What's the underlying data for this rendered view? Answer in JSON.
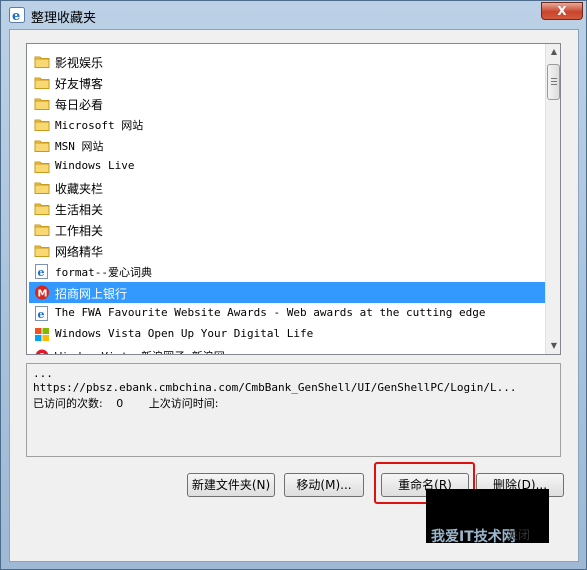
{
  "window": {
    "title": "整理收藏夹",
    "close_label": "X"
  },
  "list": {
    "items": [
      {
        "label": "影视娱乐",
        "icon": "folder-icon",
        "zh": true
      },
      {
        "label": "好友博客",
        "icon": "folder-icon",
        "zh": true
      },
      {
        "label": "每日必看",
        "icon": "folder-icon",
        "zh": true
      },
      {
        "label": "Microsoft 网站",
        "icon": "folder-icon",
        "zh": false
      },
      {
        "label": "MSN 网站",
        "icon": "folder-icon",
        "zh": false
      },
      {
        "label": "Windows Live",
        "icon": "folder-icon",
        "zh": false
      },
      {
        "label": "收藏夹栏",
        "icon": "folder-icon",
        "zh": true
      },
      {
        "label": "生活相关",
        "icon": "folder-icon",
        "zh": true
      },
      {
        "label": "工作相关",
        "icon": "folder-icon",
        "zh": true
      },
      {
        "label": "网络精华",
        "icon": "folder-icon",
        "zh": true
      },
      {
        "label": "format--爱心词典",
        "icon": "ie-page-icon",
        "zh": false
      },
      {
        "label": "招商网上银行",
        "icon": "cmb-bank-icon",
        "zh": true,
        "selected": true
      },
      {
        "label": "The FWA Favourite Website Awards - Web awards at the cutting edge",
        "icon": "ie-page-icon",
        "zh": false
      },
      {
        "label": "Windows Vista Open Up Your Digital Life",
        "icon": "windows-flag-icon",
        "zh": false
      },
      {
        "label": "WindowsVista 新浪圈子 新浪网",
        "icon": "sina-icon",
        "zh": false
      }
    ]
  },
  "details": {
    "line1": "...",
    "url": "https://pbsz.ebank.cmbchina.com/CmbBank_GenShell/UI/GenShellPC/Login/L...",
    "visits_label": "已访问的次数:",
    "visits_value": "0",
    "last_visit_label": "上次访问时间:"
  },
  "buttons": {
    "new_folder": "新建文件夹(N)",
    "move": "移动(M)...",
    "rename": "重命名(R)",
    "delete": "删除(D)..."
  },
  "watermark": {
    "text": "我爱IT技术网",
    "close_partial": "关闭"
  },
  "colors": {
    "selection": "#3399ff",
    "highlight": "#e01010"
  }
}
